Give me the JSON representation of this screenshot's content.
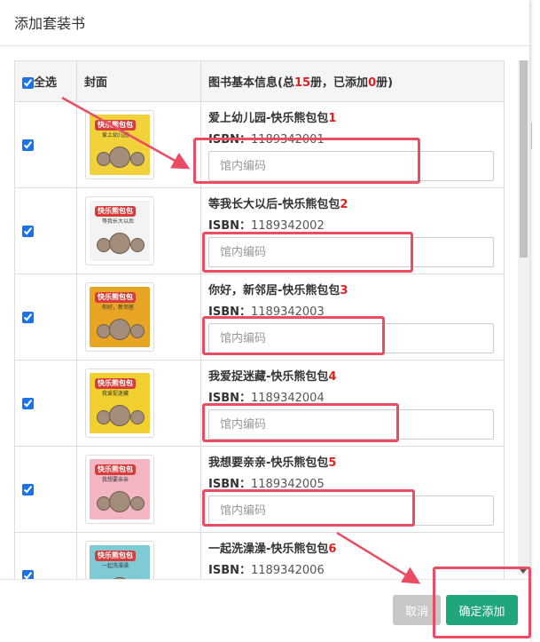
{
  "modal": {
    "title": "添加套装书"
  },
  "table": {
    "header": {
      "select_all": "全选",
      "cover": "封面",
      "info_prefix": "图书基本信息(总",
      "total": "15",
      "info_mid": "册，已添加",
      "added": "0",
      "info_suffix": "册)"
    },
    "rows": [
      {
        "title": "爱上幼儿园-快乐熊包包",
        "num": "1",
        "isbn_label": "ISBN：",
        "isbn": "1189342001",
        "placeholder": "馆内编码",
        "cover_label": "快乐熊包包",
        "cover_sub": "爱上幼儿园",
        "cover_color": "#f2d23a",
        "checked": true
      },
      {
        "title": "等我长大以后-快乐熊包包",
        "num": "2",
        "isbn_label": "ISBN：",
        "isbn": "1189342002",
        "placeholder": "馆内编码",
        "cover_label": "快乐熊包包",
        "cover_sub": "等我长大以后",
        "cover_color": "#f3f3f3",
        "checked": true
      },
      {
        "title": "你好，新邻居-快乐熊包包",
        "num": "3",
        "isbn_label": "ISBN：",
        "isbn": "1189342003",
        "placeholder": "馆内编码",
        "cover_label": "快乐熊包包",
        "cover_sub": "你好，新邻居",
        "cover_color": "#e8a523",
        "checked": true
      },
      {
        "title": "我爱捉迷藏-快乐熊包包",
        "num": "4",
        "isbn_label": "ISBN：",
        "isbn": "1189342004",
        "placeholder": "馆内编码",
        "cover_label": "快乐熊包包",
        "cover_sub": "我爱捉迷藏",
        "cover_color": "#f0cf2e",
        "checked": true
      },
      {
        "title": "我想要亲亲-快乐熊包包",
        "num": "5",
        "isbn_label": "ISBN：",
        "isbn": "1189342005",
        "placeholder": "馆内编码",
        "cover_label": "快乐熊包包",
        "cover_sub": "我想要亲亲",
        "cover_color": "#f3b6c2",
        "checked": true
      },
      {
        "title": "一起洗澡澡-快乐熊包包",
        "num": "6",
        "isbn_label": "ISBN：",
        "isbn": "1189342006",
        "placeholder": "馆内编码",
        "cover_label": "快乐熊包包",
        "cover_sub": "一起洗澡澡",
        "cover_color": "#7ecbd6",
        "checked": true
      }
    ]
  },
  "footer": {
    "cancel_label": "取消",
    "confirm_label": "确定添加"
  },
  "colors": {
    "accent_red": "#e02020",
    "confirm_green": "#20a57c",
    "cancel_gray": "#c7c7c7",
    "annotation_red": "#ea4c63"
  }
}
